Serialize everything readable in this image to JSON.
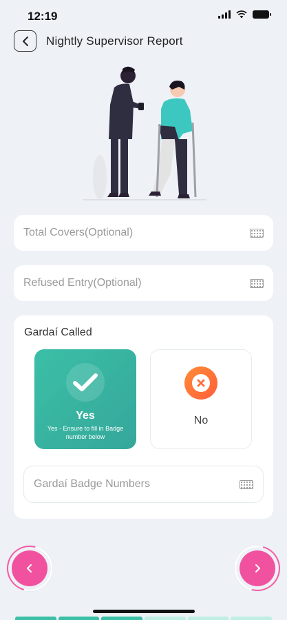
{
  "status_bar": {
    "time": "12:19"
  },
  "header": {
    "title": "Nightly Supervisor Report"
  },
  "fields": {
    "total_covers": {
      "placeholder": "Total Covers(Optional)"
    },
    "refused_entry": {
      "placeholder": "Refused Entry(Optional)"
    }
  },
  "gardai": {
    "label": "Gardaí Called",
    "yes": {
      "label": "Yes",
      "subtext": "Yes - Ensure to fill in Badge number below",
      "selected": true
    },
    "no": {
      "label": "No",
      "selected": false
    },
    "badge_numbers": {
      "placeholder": "Gardaí Badge Numbers"
    }
  },
  "colors": {
    "accent_teal": "#3bbfa6",
    "accent_pink": "#f152a0",
    "no_orange": "#ff6b3a",
    "progress_done": "#3bbfa6",
    "progress_todo": "#bfeee3"
  },
  "progress": {
    "completed_segments": 3,
    "total_segments": 6
  }
}
